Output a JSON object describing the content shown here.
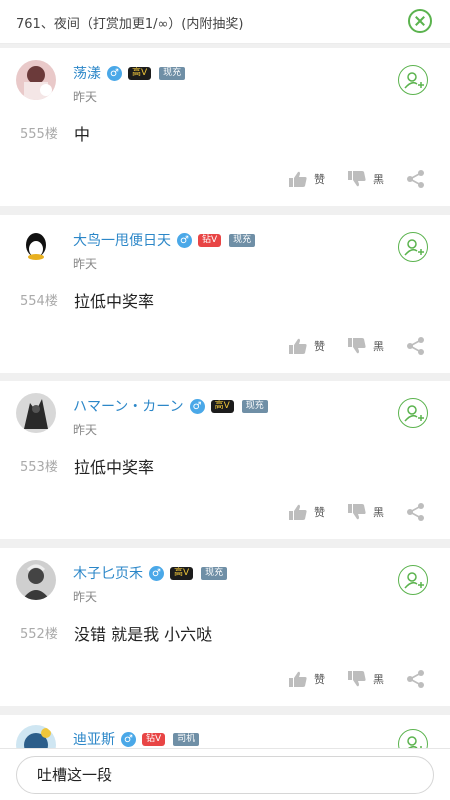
{
  "header": {
    "title": "761、夜间（打赏加更1/∞）(内附抽奖)",
    "close_icon": "close-circle-icon"
  },
  "colors": {
    "accent_green": "#5bb34e",
    "username_blue": "#2c87c8",
    "badge_red": "#e84545"
  },
  "comments": [
    {
      "username": "荡漾",
      "gender": "♂",
      "badge": "高V",
      "tag": "现充",
      "time": "昨天",
      "floor": "555楼",
      "content": "中",
      "like_label": "赞",
      "dislike_label": "黑"
    },
    {
      "username": "大鸟一甩便日天",
      "gender": "♂",
      "badge": "钻V",
      "tag": "现充",
      "time": "昨天",
      "floor": "554楼",
      "content": "拉低中奖率",
      "like_label": "赞",
      "dislike_label": "黑"
    },
    {
      "username": "ハマーン・カーン",
      "gender": "♂",
      "badge": "高V",
      "tag": "现充",
      "time": "昨天",
      "floor": "553楼",
      "content": "拉低中奖率",
      "like_label": "赞",
      "dislike_label": "黑"
    },
    {
      "username": "木子匕页禾",
      "gender": "♂",
      "badge": "高V",
      "tag": "现充",
      "time": "昨天",
      "floor": "552楼",
      "content": "没错 就是我 小六哒",
      "like_label": "赞",
      "dislike_label": "黑"
    },
    {
      "username": "迪亚斯",
      "gender": "♂",
      "badge": "钻V",
      "tag": "司机"
    }
  ],
  "footer": {
    "input_placeholder": "吐槽这一段"
  }
}
